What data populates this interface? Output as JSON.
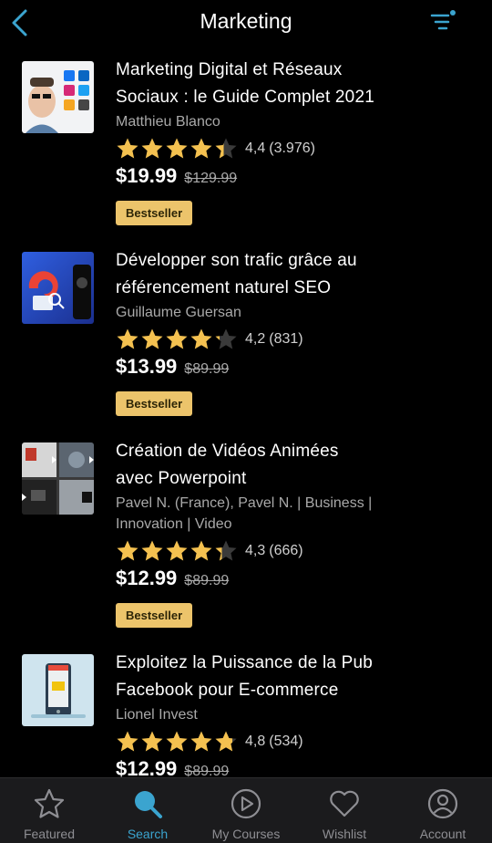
{
  "header": {
    "title": "Marketing",
    "back_icon": "chevron-left-icon",
    "filter_icon": "filter-icon",
    "accent_color": "#3ba4cf"
  },
  "courses": [
    {
      "title_line1": "Marketing Digital et Réseaux",
      "title_line2": "Sociaux : le Guide Complet 2021",
      "author_line1": "Matthieu Blanco",
      "author_line2": "",
      "rating": "4,4",
      "count": "(3.976)",
      "stars": 4.4,
      "price": "$19.99",
      "old_price": "$129.99",
      "badge": "Bestseller"
    },
    {
      "title_line1": "Développer son trafic grâce au",
      "title_line2": "référencement naturel SEO",
      "author_line1": "Guillaume Guersan",
      "author_line2": "",
      "rating": "4,2",
      "count": "(831)",
      "stars": 4.2,
      "price": "$13.99",
      "old_price": "$89.99",
      "badge": "Bestseller"
    },
    {
      "title_line1": "Création de Vidéos Animées",
      "title_line2": "avec Powerpoint",
      "author_line1": "Pavel N. (France), Pavel N. | Business |",
      "author_line2": "Innovation | Video",
      "rating": "4,3",
      "count": "(666)",
      "stars": 4.3,
      "price": "$12.99",
      "old_price": "$89.99",
      "badge": "Bestseller"
    },
    {
      "title_line1": "Exploitez la Puissance de la Pub",
      "title_line2": "Facebook pour E-commerce",
      "author_line1": "Lionel Invest",
      "author_line2": "",
      "rating": "4,8",
      "count": "(534)",
      "stars": 4.8,
      "price": "$12.99",
      "old_price": "$89.99",
      "badge": ""
    }
  ],
  "tabs": [
    {
      "label": "Featured",
      "icon": "star-icon",
      "active": false
    },
    {
      "label": "Search",
      "icon": "search-icon",
      "active": true
    },
    {
      "label": "My Courses",
      "icon": "play-circle-icon",
      "active": false
    },
    {
      "label": "Wishlist",
      "icon": "heart-icon",
      "active": false
    },
    {
      "label": "Account",
      "icon": "account-icon",
      "active": false
    }
  ],
  "colors": {
    "star": "#f4c150",
    "badge_bg": "#ecc46b",
    "tab_active": "#3ba4cf",
    "tab_inactive": "#8e8e93"
  }
}
